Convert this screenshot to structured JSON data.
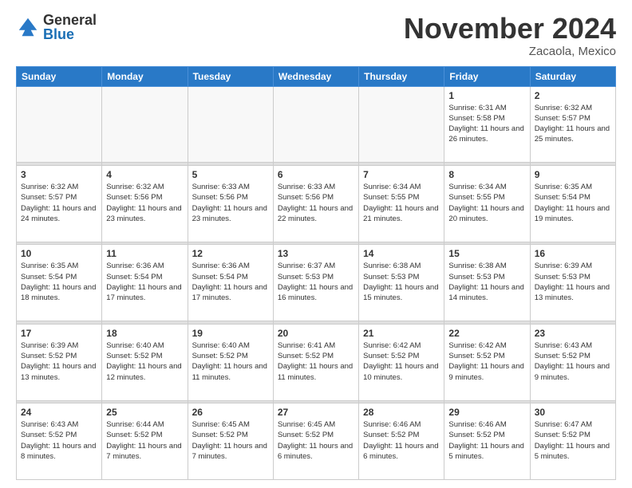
{
  "logo": {
    "general": "General",
    "blue": "Blue"
  },
  "header": {
    "month": "November 2024",
    "location": "Zacaola, Mexico"
  },
  "weekdays": [
    "Sunday",
    "Monday",
    "Tuesday",
    "Wednesday",
    "Thursday",
    "Friday",
    "Saturday"
  ],
  "weeks": [
    [
      {
        "day": "",
        "info": ""
      },
      {
        "day": "",
        "info": ""
      },
      {
        "day": "",
        "info": ""
      },
      {
        "day": "",
        "info": ""
      },
      {
        "day": "",
        "info": ""
      },
      {
        "day": "1",
        "info": "Sunrise: 6:31 AM\nSunset: 5:58 PM\nDaylight: 11 hours and 26 minutes."
      },
      {
        "day": "2",
        "info": "Sunrise: 6:32 AM\nSunset: 5:57 PM\nDaylight: 11 hours and 25 minutes."
      }
    ],
    [
      {
        "day": "3",
        "info": "Sunrise: 6:32 AM\nSunset: 5:57 PM\nDaylight: 11 hours and 24 minutes."
      },
      {
        "day": "4",
        "info": "Sunrise: 6:32 AM\nSunset: 5:56 PM\nDaylight: 11 hours and 23 minutes."
      },
      {
        "day": "5",
        "info": "Sunrise: 6:33 AM\nSunset: 5:56 PM\nDaylight: 11 hours and 23 minutes."
      },
      {
        "day": "6",
        "info": "Sunrise: 6:33 AM\nSunset: 5:56 PM\nDaylight: 11 hours and 22 minutes."
      },
      {
        "day": "7",
        "info": "Sunrise: 6:34 AM\nSunset: 5:55 PM\nDaylight: 11 hours and 21 minutes."
      },
      {
        "day": "8",
        "info": "Sunrise: 6:34 AM\nSunset: 5:55 PM\nDaylight: 11 hours and 20 minutes."
      },
      {
        "day": "9",
        "info": "Sunrise: 6:35 AM\nSunset: 5:54 PM\nDaylight: 11 hours and 19 minutes."
      }
    ],
    [
      {
        "day": "10",
        "info": "Sunrise: 6:35 AM\nSunset: 5:54 PM\nDaylight: 11 hours and 18 minutes."
      },
      {
        "day": "11",
        "info": "Sunrise: 6:36 AM\nSunset: 5:54 PM\nDaylight: 11 hours and 17 minutes."
      },
      {
        "day": "12",
        "info": "Sunrise: 6:36 AM\nSunset: 5:54 PM\nDaylight: 11 hours and 17 minutes."
      },
      {
        "day": "13",
        "info": "Sunrise: 6:37 AM\nSunset: 5:53 PM\nDaylight: 11 hours and 16 minutes."
      },
      {
        "day": "14",
        "info": "Sunrise: 6:38 AM\nSunset: 5:53 PM\nDaylight: 11 hours and 15 minutes."
      },
      {
        "day": "15",
        "info": "Sunrise: 6:38 AM\nSunset: 5:53 PM\nDaylight: 11 hours and 14 minutes."
      },
      {
        "day": "16",
        "info": "Sunrise: 6:39 AM\nSunset: 5:53 PM\nDaylight: 11 hours and 13 minutes."
      }
    ],
    [
      {
        "day": "17",
        "info": "Sunrise: 6:39 AM\nSunset: 5:52 PM\nDaylight: 11 hours and 13 minutes."
      },
      {
        "day": "18",
        "info": "Sunrise: 6:40 AM\nSunset: 5:52 PM\nDaylight: 11 hours and 12 minutes."
      },
      {
        "day": "19",
        "info": "Sunrise: 6:40 AM\nSunset: 5:52 PM\nDaylight: 11 hours and 11 minutes."
      },
      {
        "day": "20",
        "info": "Sunrise: 6:41 AM\nSunset: 5:52 PM\nDaylight: 11 hours and 11 minutes."
      },
      {
        "day": "21",
        "info": "Sunrise: 6:42 AM\nSunset: 5:52 PM\nDaylight: 11 hours and 10 minutes."
      },
      {
        "day": "22",
        "info": "Sunrise: 6:42 AM\nSunset: 5:52 PM\nDaylight: 11 hours and 9 minutes."
      },
      {
        "day": "23",
        "info": "Sunrise: 6:43 AM\nSunset: 5:52 PM\nDaylight: 11 hours and 9 minutes."
      }
    ],
    [
      {
        "day": "24",
        "info": "Sunrise: 6:43 AM\nSunset: 5:52 PM\nDaylight: 11 hours and 8 minutes."
      },
      {
        "day": "25",
        "info": "Sunrise: 6:44 AM\nSunset: 5:52 PM\nDaylight: 11 hours and 7 minutes."
      },
      {
        "day": "26",
        "info": "Sunrise: 6:45 AM\nSunset: 5:52 PM\nDaylight: 11 hours and 7 minutes."
      },
      {
        "day": "27",
        "info": "Sunrise: 6:45 AM\nSunset: 5:52 PM\nDaylight: 11 hours and 6 minutes."
      },
      {
        "day": "28",
        "info": "Sunrise: 6:46 AM\nSunset: 5:52 PM\nDaylight: 11 hours and 6 minutes."
      },
      {
        "day": "29",
        "info": "Sunrise: 6:46 AM\nSunset: 5:52 PM\nDaylight: 11 hours and 5 minutes."
      },
      {
        "day": "30",
        "info": "Sunrise: 6:47 AM\nSunset: 5:52 PM\nDaylight: 11 hours and 5 minutes."
      }
    ]
  ]
}
